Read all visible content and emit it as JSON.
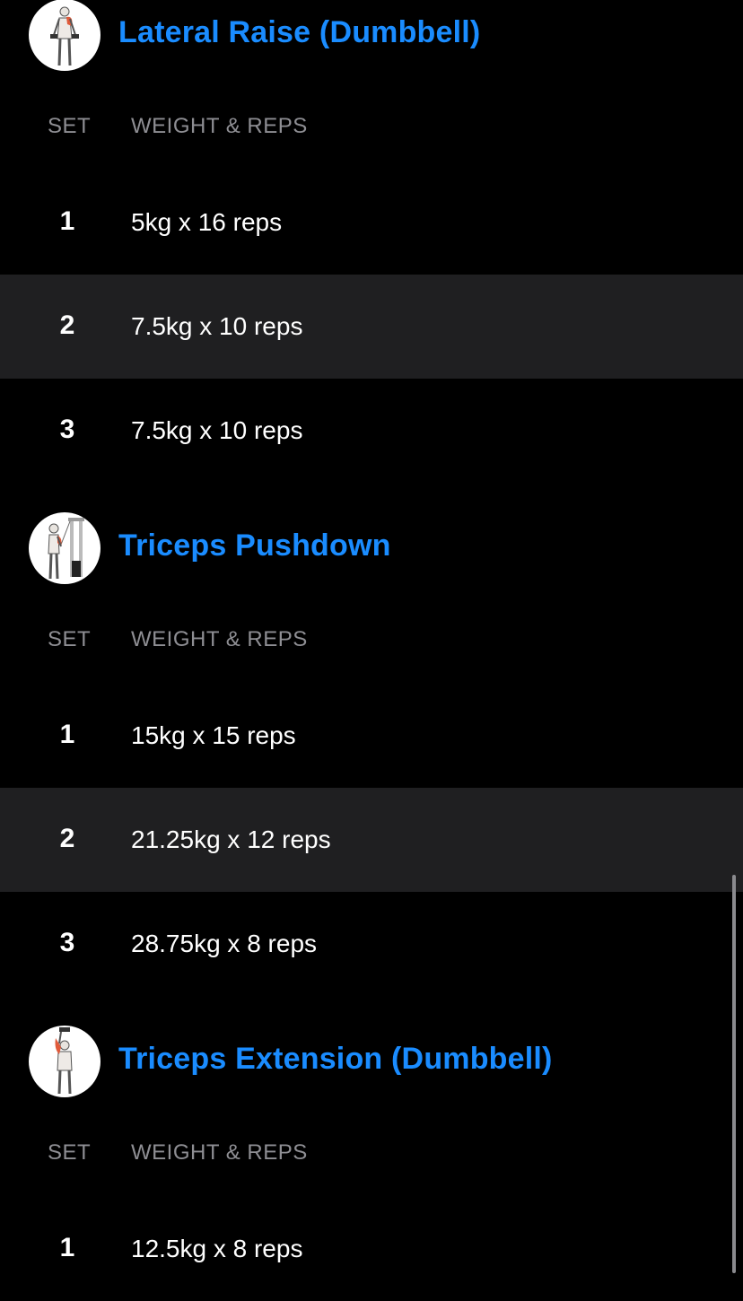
{
  "columns": {
    "set": "SET",
    "weight_reps": "WEIGHT & REPS"
  },
  "exercises": [
    {
      "name": "Lateral Raise (Dumbbell)",
      "thumbnail_icon": "lateral-raise-figure-icon",
      "sets": [
        {
          "num": "1",
          "value": "5kg x 16 reps"
        },
        {
          "num": "2",
          "value": "7.5kg x 10 reps"
        },
        {
          "num": "3",
          "value": "7.5kg x 10 reps"
        }
      ]
    },
    {
      "name": "Triceps Pushdown",
      "thumbnail_icon": "triceps-pushdown-figure-icon",
      "sets": [
        {
          "num": "1",
          "value": "15kg x 15 reps"
        },
        {
          "num": "2",
          "value": "21.25kg x 12 reps"
        },
        {
          "num": "3",
          "value": "28.75kg x 8 reps"
        }
      ]
    },
    {
      "name": "Triceps Extension (Dumbbell)",
      "thumbnail_icon": "triceps-extension-figure-icon",
      "sets": [
        {
          "num": "1",
          "value": "12.5kg x 8 reps"
        }
      ]
    }
  ],
  "colors": {
    "background": "#000000",
    "alt_row": "#1f1f21",
    "accent_title": "#1a8cff",
    "column_header": "#8e8e93",
    "text": "#ffffff"
  }
}
